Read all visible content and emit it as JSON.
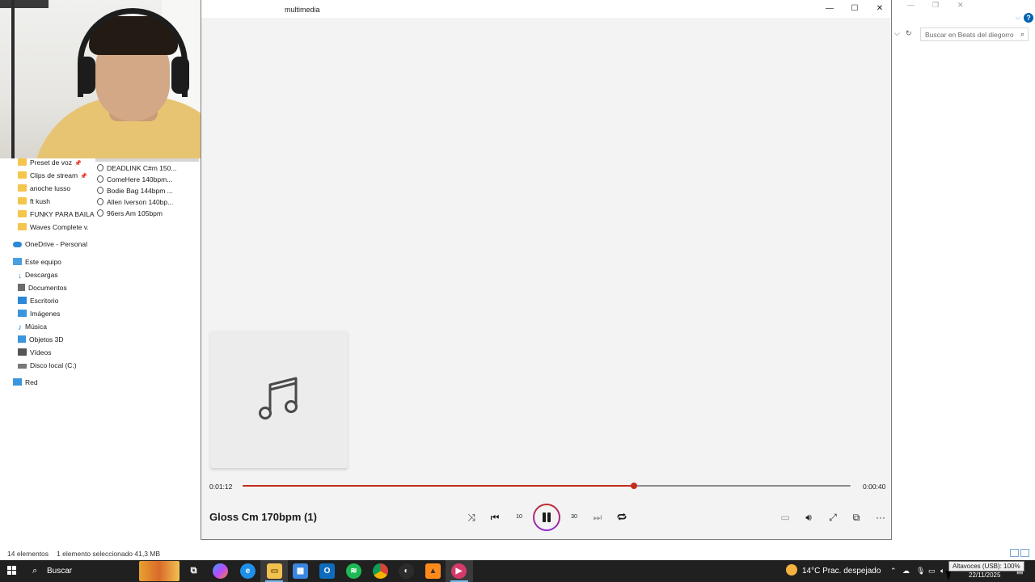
{
  "explorer": {
    "search_placeholder": "Buscar en Beats del diegorro",
    "quick_access": [
      {
        "label": "Preset de voz",
        "pinned": true
      },
      {
        "label": "Clips de stream",
        "pinned": true
      },
      {
        "label": "anoche lusso",
        "pinned": false
      },
      {
        "label": "ft kush",
        "pinned": false
      },
      {
        "label": "FUNKY PARA BAILA",
        "pinned": false
      },
      {
        "label": "Waves Complete v.",
        "pinned": false
      }
    ],
    "onedrive_label": "OneDrive - Personal",
    "this_pc_label": "Este equipo",
    "this_pc_items": [
      {
        "label": "Descargas",
        "icon": "download-arrow-icon",
        "color": "#2b88d8"
      },
      {
        "label": "Documentos",
        "icon": "document-icon",
        "color": "#6b6b6b"
      },
      {
        "label": "Escritorio",
        "icon": "desktop-icon",
        "color": "#2b88d8"
      },
      {
        "label": "Imágenes",
        "icon": "pictures-icon",
        "color": "#3a96dd"
      },
      {
        "label": "Música",
        "icon": "music-note-icon",
        "color": "#2b88d8"
      },
      {
        "label": "Objetos 3D",
        "icon": "cube-3d-icon",
        "color": "#3a96dd"
      },
      {
        "label": "Vídeos",
        "icon": "video-icon",
        "color": "#555555"
      },
      {
        "label": "Disco local (C:)",
        "icon": "drive-icon",
        "color": "#777777"
      }
    ],
    "network_label": "Red",
    "files": [
      "DEADLINK C#m 150...",
      "ComeHere 140bpm...",
      "Bodie Bag 144bpm ...",
      "Allen Iverson 140bp...",
      "96ers Am 105bpm"
    ],
    "status_count": "14 elementos",
    "status_selection": "1 elemento seleccionado  41,3 MB"
  },
  "player": {
    "window_title": "multimedia",
    "track_title": "Gloss Cm 170bpm (1)",
    "time_elapsed": "0:01:12",
    "time_remaining": "0:00:40",
    "progress_fraction": 0.643,
    "accent_color": "#c42b1c",
    "skip_back_label": "10",
    "skip_forward_label": "30"
  },
  "taskbar": {
    "search_label": "Buscar",
    "weather": "14°C  Prac. despejado",
    "tooltip": "Altavoces (USB): 100%",
    "date": "22/11/2025"
  }
}
